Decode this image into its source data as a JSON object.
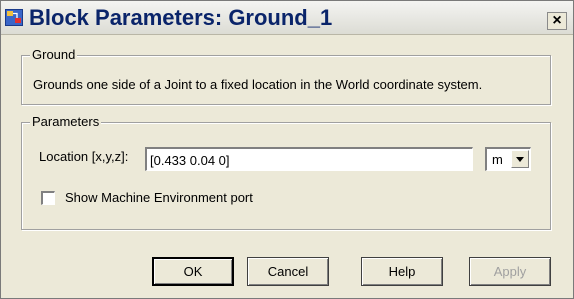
{
  "window": {
    "title": "Block Parameters: Ground_1",
    "close_label": "×"
  },
  "ground_group": {
    "legend": "Ground",
    "description": "Grounds one side of a Joint to a fixed location in the World coordinate system."
  },
  "parameters_group": {
    "legend": "Parameters",
    "location_label": "Location [x,y,z]:",
    "location_value": "[0.433 0.04 0]",
    "unit_selected": "m",
    "checkbox_label": "Show Machine Environment port",
    "checkbox_checked": false
  },
  "buttons": {
    "ok": "OK",
    "cancel": "Cancel",
    "help": "Help",
    "apply": "Apply"
  },
  "colors": {
    "title_text": "#0a246a",
    "dialog_bg": "#ece9d8",
    "disabled_text": "#a0a0a0"
  },
  "icons": {
    "app": "simulink-block-icon",
    "unit_dropdown": "chevron-down-icon"
  }
}
